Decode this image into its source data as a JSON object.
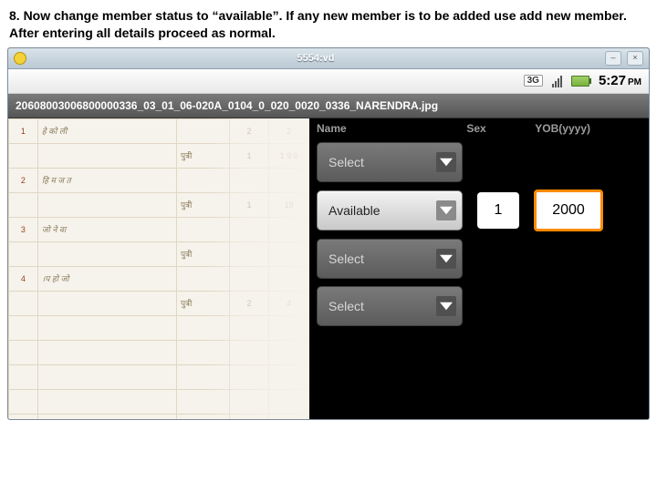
{
  "instruction": "8. Now change member status to “available”. If any new member is to be added use add new member. After entering all details proceed as normal.",
  "emulator": {
    "title": "5554:vd",
    "minimize": "–",
    "close": "×"
  },
  "statusbar": {
    "network": "3G",
    "time": "5:27",
    "ampm": "PM"
  },
  "filebar": {
    "filename": "20608003006800000336_03_01_06-020A_0104_0_020_0020_0336_NARENDRA.jpg"
  },
  "headers": {
    "name": "Name",
    "sex": "Sex",
    "yob": "YOB(yyyy)"
  },
  "rows": {
    "r1": {
      "spinner": "Select"
    },
    "r2": {
      "spinner": "Available",
      "sex": "1",
      "yob": "2000"
    },
    "r3": {
      "spinner": "Select"
    },
    "r4": {
      "spinner": "Select"
    }
  },
  "ledger": {
    "r1": {
      "n": "1",
      "name": "हे को ली",
      "rel": "",
      "a": "2",
      "b": "2"
    },
    "r2": {
      "n": "",
      "name": "",
      "rel": "पुत्री",
      "a": "1",
      "b": "1 9 8"
    },
    "r3": {
      "n": "2",
      "name": "हि म ज त",
      "rel": "",
      "a": "",
      "b": ""
    },
    "r4": {
      "n": "",
      "name": "",
      "rel": "पुत्री",
      "a": "1",
      "b": "19"
    },
    "r5": {
      "n": "3",
      "name": "जो ने वा",
      "rel": "",
      "a": "",
      "b": ""
    },
    "r6": {
      "n": "",
      "name": "",
      "rel": "पुत्री",
      "a": "",
      "b": ""
    },
    "r7": {
      "n": "4",
      "name": "।प हो जो",
      "rel": "",
      "a": "",
      "b": ""
    },
    "r8": {
      "n": "",
      "name": "",
      "rel": "पुत्री",
      "a": "2",
      "b": "4"
    }
  }
}
